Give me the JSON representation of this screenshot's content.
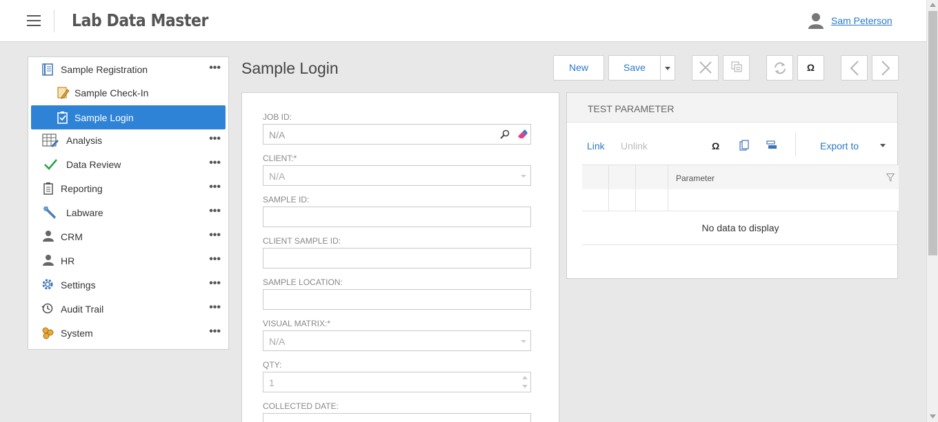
{
  "header": {
    "app_title": "Lab Data Master",
    "user_name": "Sam Peterson"
  },
  "sidebar": {
    "items": [
      {
        "label": "Sample Registration",
        "icon": "registration-icon",
        "has_menu": true
      },
      {
        "label": "Sample Check-In",
        "icon": "check-in-icon",
        "has_menu": false
      },
      {
        "label": "Sample Login",
        "icon": "clipboard-check-icon",
        "has_menu": false,
        "active": true
      },
      {
        "label": "Analysis",
        "icon": "analysis-icon",
        "has_menu": true
      },
      {
        "label": "Data Review",
        "icon": "checkmark-icon",
        "has_menu": true
      },
      {
        "label": "Reporting",
        "icon": "report-icon",
        "has_menu": true
      },
      {
        "label": "Labware",
        "icon": "wrench-icon",
        "has_menu": true
      },
      {
        "label": "CRM",
        "icon": "person-icon",
        "has_menu": true
      },
      {
        "label": "HR",
        "icon": "person-icon",
        "has_menu": true
      },
      {
        "label": "Settings",
        "icon": "gear-icon",
        "has_menu": true
      },
      {
        "label": "Audit Trail",
        "icon": "history-icon",
        "has_menu": true
      },
      {
        "label": "System",
        "icon": "system-icon",
        "has_menu": true
      }
    ],
    "dots": "•••"
  },
  "page": {
    "title": "Sample Login"
  },
  "toolbar": {
    "new_label": "New",
    "save_label": "Save",
    "omega_label": "Ω"
  },
  "form": {
    "job_id_label": "JOB ID:",
    "job_id_value": "N/A",
    "client_label": "CLIENT:*",
    "client_value": "N/A",
    "sample_id_label": "SAMPLE ID:",
    "sample_id_value": "",
    "client_sample_id_label": "CLIENT SAMPLE ID:",
    "client_sample_id_value": "",
    "sample_location_label": "SAMPLE LOCATION:",
    "sample_location_value": "",
    "visual_matrix_label": "VISUAL MATRIX:*",
    "visual_matrix_value": "N/A",
    "qty_label": "QTY:",
    "qty_value": "1",
    "collected_date_label": "COLLECTED DATE:",
    "collected_date_value": ""
  },
  "test_parameter": {
    "title": "TEST PARAMETER",
    "link_label": "Link",
    "unlink_label": "Unlink",
    "omega_label": "Ω",
    "export_label": "Export to",
    "column_parameter": "Parameter",
    "empty_text": "No data to display"
  },
  "colors": {
    "accent": "#2f83d6",
    "link": "#2a7ac8"
  }
}
